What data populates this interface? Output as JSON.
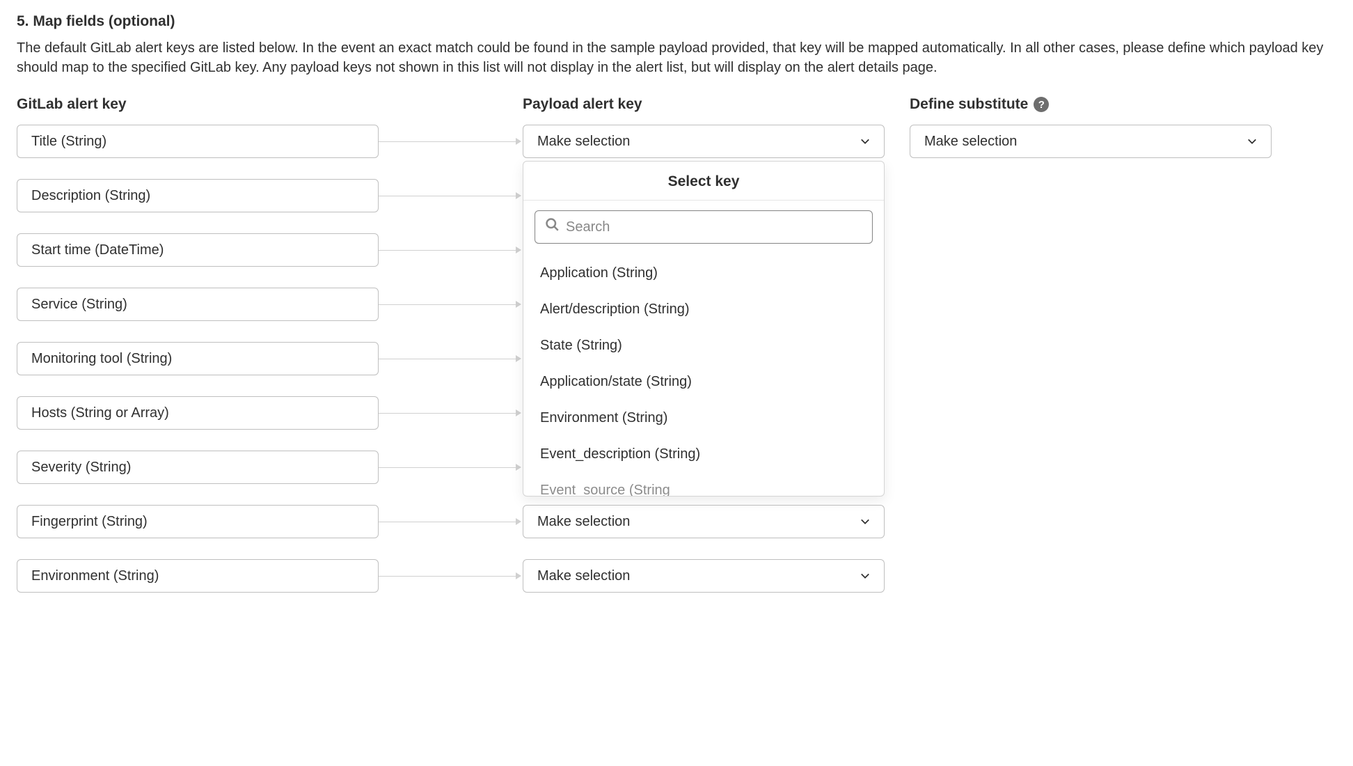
{
  "section": {
    "heading": "5. Map fields (optional)",
    "description": "The default GitLab alert keys are listed below. In the event an exact match could be found in the sample payload provided, that key will be mapped automatically. In all other cases, please define which payload key should map to the specified GitLab key. Any payload keys not shown in this list will not display in the alert list, but will display on the alert details page."
  },
  "columns": {
    "gitlab": "GitLab alert key",
    "payload": "Payload alert key",
    "substitute": "Define substitute"
  },
  "placeholders": {
    "make_selection": "Make selection",
    "search": "Search",
    "select_key_title": "Select key"
  },
  "rows": [
    {
      "gitlab": "Title (String)"
    },
    {
      "gitlab": "Description (String)"
    },
    {
      "gitlab": "Start time (DateTime)"
    },
    {
      "gitlab": "Service (String)"
    },
    {
      "gitlab": "Monitoring tool (String)"
    },
    {
      "gitlab": "Hosts (String or Array)"
    },
    {
      "gitlab": "Severity (String)"
    },
    {
      "gitlab": "Fingerprint (String)"
    },
    {
      "gitlab": "Environment (String)"
    }
  ],
  "dropdown_options": [
    "Application (String)",
    "Alert/description (String)",
    "State (String)",
    "Application/state (String)",
    "Environment (String)",
    "Event_description (String)",
    "Event_source (String"
  ]
}
